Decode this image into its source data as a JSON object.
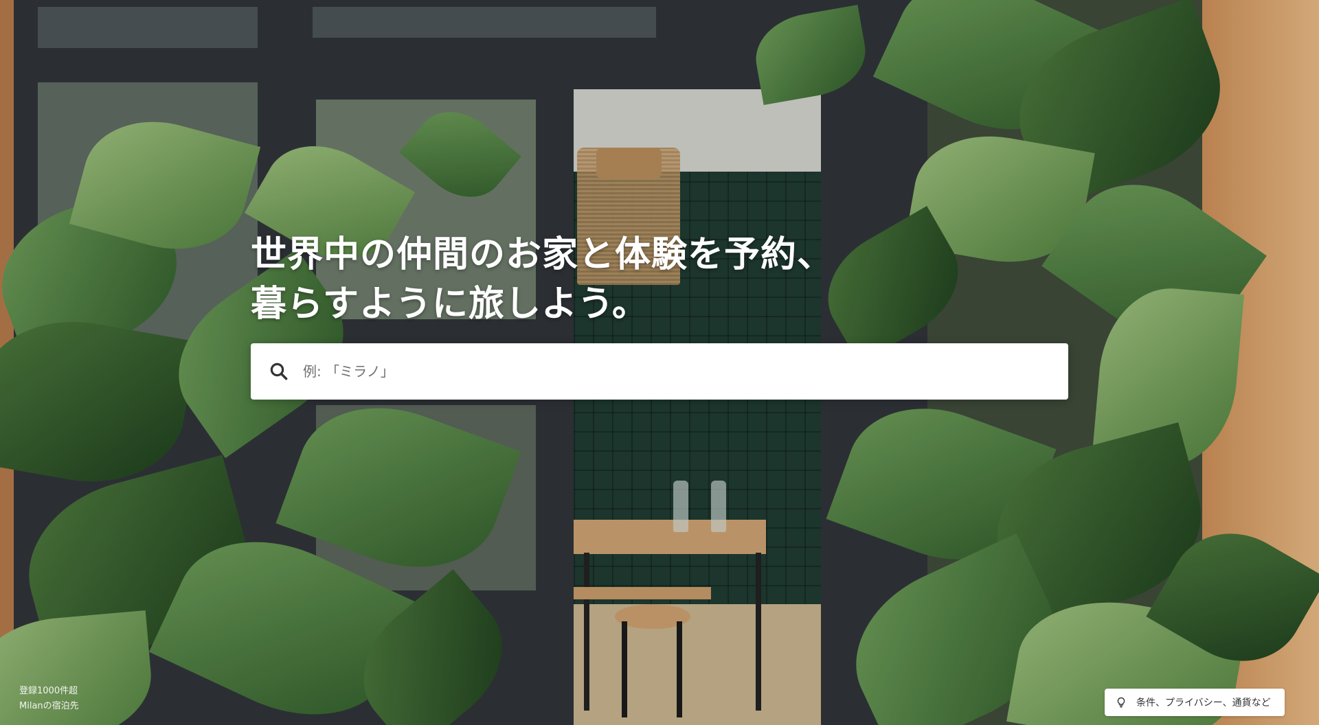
{
  "hero": {
    "title_line1": "世界中の仲間のお家と体験を予約、",
    "title_line2": "暮らすように旅しよう。"
  },
  "search": {
    "icon": "search-icon",
    "placeholder": "例: 「ミラノ」"
  },
  "listing_stat": {
    "line1": "登録1000件超",
    "line2": "Milanの宿泊先"
  },
  "footer": {
    "icon": "lightbulb-icon",
    "label": "条件、プライバシー、通貨など"
  },
  "colors": {
    "text_on_image": "#ffffff",
    "search_background": "#ffffff",
    "placeholder": "#6e6e6e"
  }
}
